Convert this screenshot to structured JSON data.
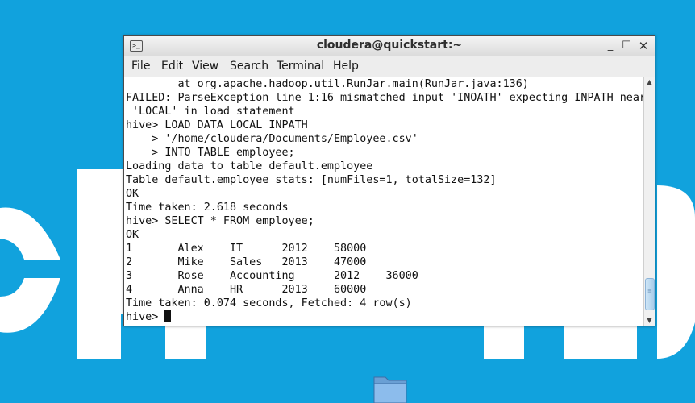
{
  "window": {
    "title": "cloudera@quickstart:~",
    "icon": "terminal-icon",
    "min_glyph": "_",
    "max_glyph": "☐",
    "close_glyph": "✕"
  },
  "menu": [
    "File",
    "Edit",
    "View",
    "Search",
    "Terminal",
    "Help"
  ],
  "terminal": {
    "lines": [
      "        at org.apache.hadoop.util.RunJar.main(RunJar.java:136)",
      "FAILED: ParseException line 1:16 mismatched input 'INOATH' expecting INPATH near",
      " 'LOCAL' in load statement",
      "hive> LOAD DATA LOCAL INPATH",
      "    > '/home/cloudera/Documents/Employee.csv'",
      "    > INTO TABLE employee;",
      "Loading data to table default.employee",
      "Table default.employee stats: [numFiles=1, totalSize=132]",
      "OK",
      "Time taken: 2.618 seconds",
      "hive> SELECT * FROM employee;",
      "OK",
      "1       Alex    IT      2012    58000",
      "2       Mike    Sales   2013    47000",
      "3       Rose    Accounting      2012    36000",
      "4       Anna    HR      2013    60000",
      "Time taken: 0.074 seconds, Fetched: 4 row(s)"
    ],
    "prompt": "hive> "
  },
  "scrollbar": {
    "up_glyph": "▲",
    "down_glyph": "▼",
    "grip_glyph": "≡"
  },
  "desktop": {
    "icons": [
      "folder-icon"
    ],
    "accent": "#11a2dd"
  }
}
